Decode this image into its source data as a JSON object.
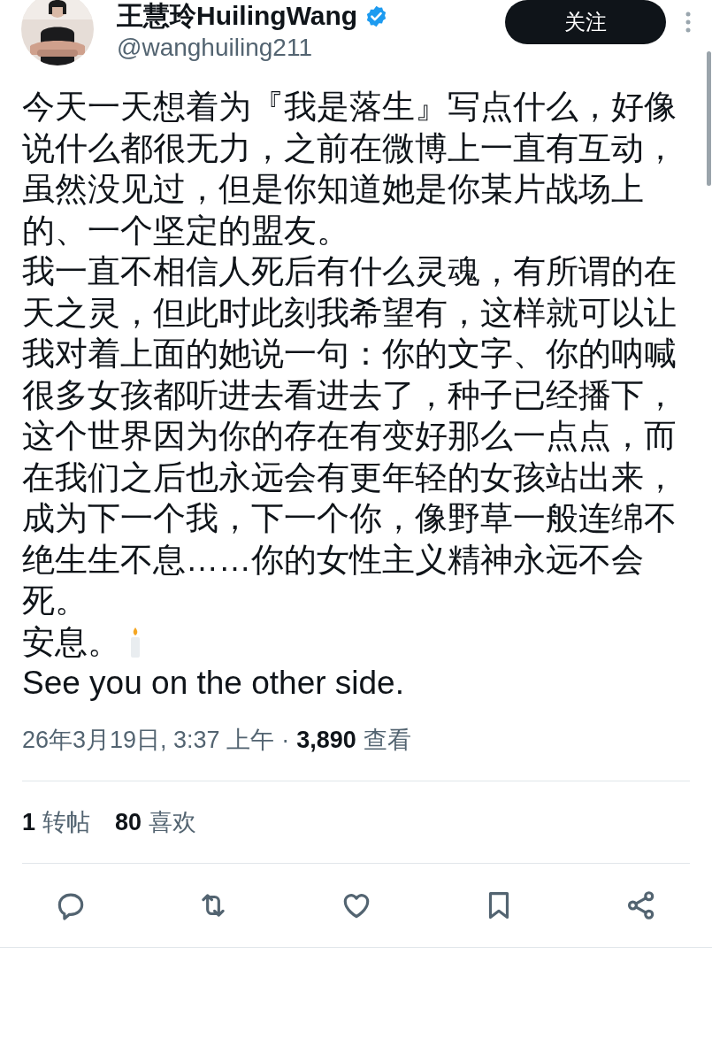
{
  "author": {
    "name": "王慧玲HuilingWang",
    "verified": true,
    "handle": "@wanghuiling211",
    "follow_button": "关注"
  },
  "tweet": {
    "paragraphs": [
      {
        "kind": "text",
        "text": "今天一天想着为『我是落生』写点什么，好像说什么都很无力，之前在微博上一直有互动，虽然没见过，但是你知道她是你某片战场上的、一个坚定的盟友。"
      },
      {
        "kind": "text",
        "text": "我一直不相信人死后有什么灵魂，有所谓的在天之灵，但此时此刻我希望有，这样就可以让我对着上面的她说一句：你的文字、你的呐喊很多女孩都听进去看进去了，种子已经播下，这个世界因为你的存在有变好那么一点点，而在我们之后也永远会有更年轻的女孩站出来，成为下一个我，下一个你，像野草一般连绵不绝生生不息……你的女性主义精神永远不会死。"
      },
      {
        "kind": "text_with_candle",
        "text": "安息。"
      },
      {
        "kind": "text",
        "text": "See you on the other side."
      }
    ]
  },
  "meta": {
    "timestamp": "26年3月19日, 3:37 上午",
    "separator": "·",
    "views_count": "3,890",
    "views_label": "查看"
  },
  "stats": [
    {
      "count": "1",
      "label": "转帖"
    },
    {
      "count": "80",
      "label": "喜欢"
    }
  ],
  "actions": [
    {
      "kind": "reply"
    },
    {
      "kind": "repost"
    },
    {
      "kind": "like"
    },
    {
      "kind": "bookmark"
    },
    {
      "kind": "share"
    }
  ]
}
